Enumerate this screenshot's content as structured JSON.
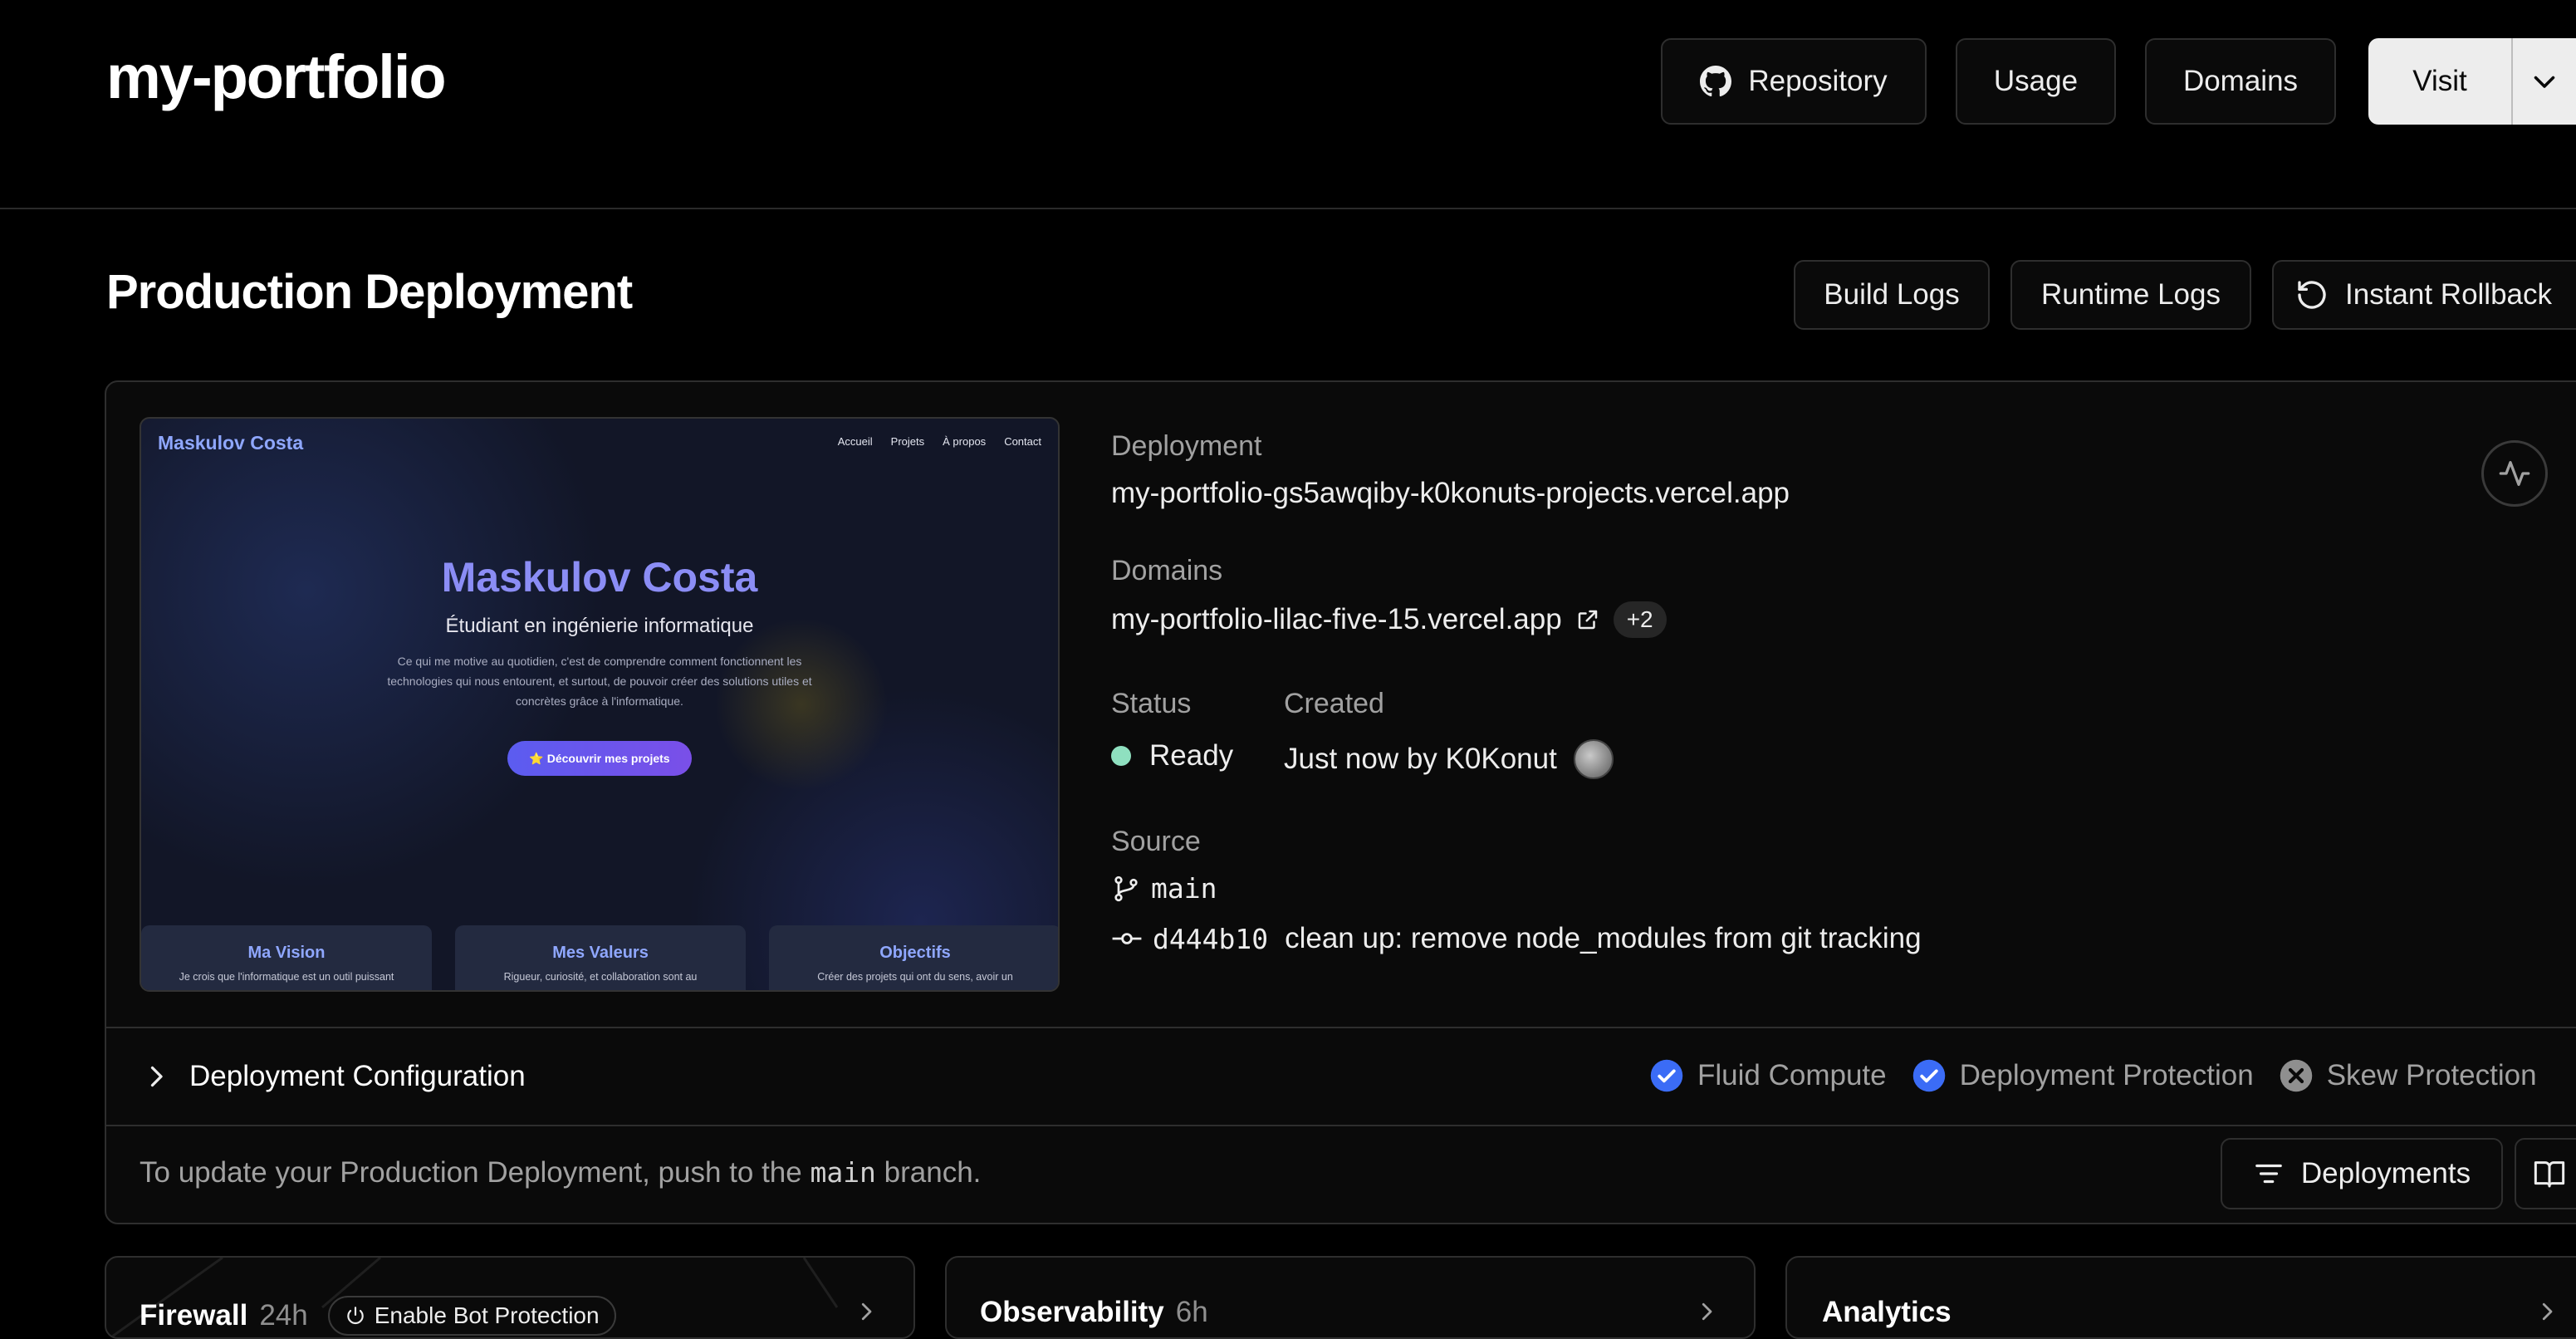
{
  "header": {
    "project_name": "my-portfolio",
    "repository_label": "Repository",
    "usage_label": "Usage",
    "domains_label": "Domains",
    "visit_label": "Visit"
  },
  "production": {
    "title": "Production Deployment",
    "build_logs_label": "Build Logs",
    "runtime_logs_label": "Runtime Logs",
    "rollback_label": "Instant Rollback"
  },
  "preview": {
    "brand": "Maskulov Costa",
    "nav": [
      "Accueil",
      "Projets",
      "À propos",
      "Contact"
    ],
    "hero_title": "Maskulov Costa",
    "hero_subtitle": "Étudiant en ingénierie informatique",
    "hero_text_1": "Ce qui me motive au quotidien, c'est de comprendre comment fonctionnent les",
    "hero_text_2": "technologies qui nous entourent, et surtout, de pouvoir créer des solutions utiles et",
    "hero_text_3": "concrètes grâce à l'informatique.",
    "cta": "⭐ Découvrir mes projets",
    "cards": [
      {
        "title": "Ma Vision",
        "text": "Je crois que l'informatique est un outil puissant"
      },
      {
        "title": "Mes Valeurs",
        "text": "Rigueur, curiosité, et collaboration sont au"
      },
      {
        "title": "Objectifs",
        "text": "Créer des projets qui ont du sens, avoir un"
      }
    ]
  },
  "deployment": {
    "deployment_label": "Deployment",
    "deployment_url": "my-portfolio-gs5awqiby-k0konuts-projects.vercel.app",
    "domains_label": "Domains",
    "domain_url": "my-portfolio-lilac-five-15.vercel.app",
    "domains_extra": "+2",
    "status_label": "Status",
    "status_value": "Ready",
    "status_color": "#50e3c2",
    "created_label": "Created",
    "created_value": "Just now by K0Konut",
    "source_label": "Source",
    "branch": "main",
    "commit_sha": "d444b10",
    "commit_message": "clean up: remove node_modules from git tracking"
  },
  "config": {
    "title": "Deployment Configuration",
    "features": [
      {
        "label": "Fluid Compute",
        "enabled": true
      },
      {
        "label": "Deployment Protection",
        "enabled": true
      },
      {
        "label": "Skew Protection",
        "enabled": false
      }
    ]
  },
  "footer": {
    "text_prefix": "To update your Production Deployment, push to the ",
    "branch": "main",
    "text_suffix": " branch.",
    "deployments_label": "Deployments"
  },
  "bottom_cards": {
    "firewall_title": "Firewall",
    "firewall_period": "24h",
    "bot_protection_label": "Enable Bot Protection",
    "observability_title": "Observability",
    "observability_period": "6h",
    "analytics_title": "Analytics"
  },
  "colors": {
    "accent_blue": "#3b82f6",
    "ready_green": "#50e3c2"
  }
}
